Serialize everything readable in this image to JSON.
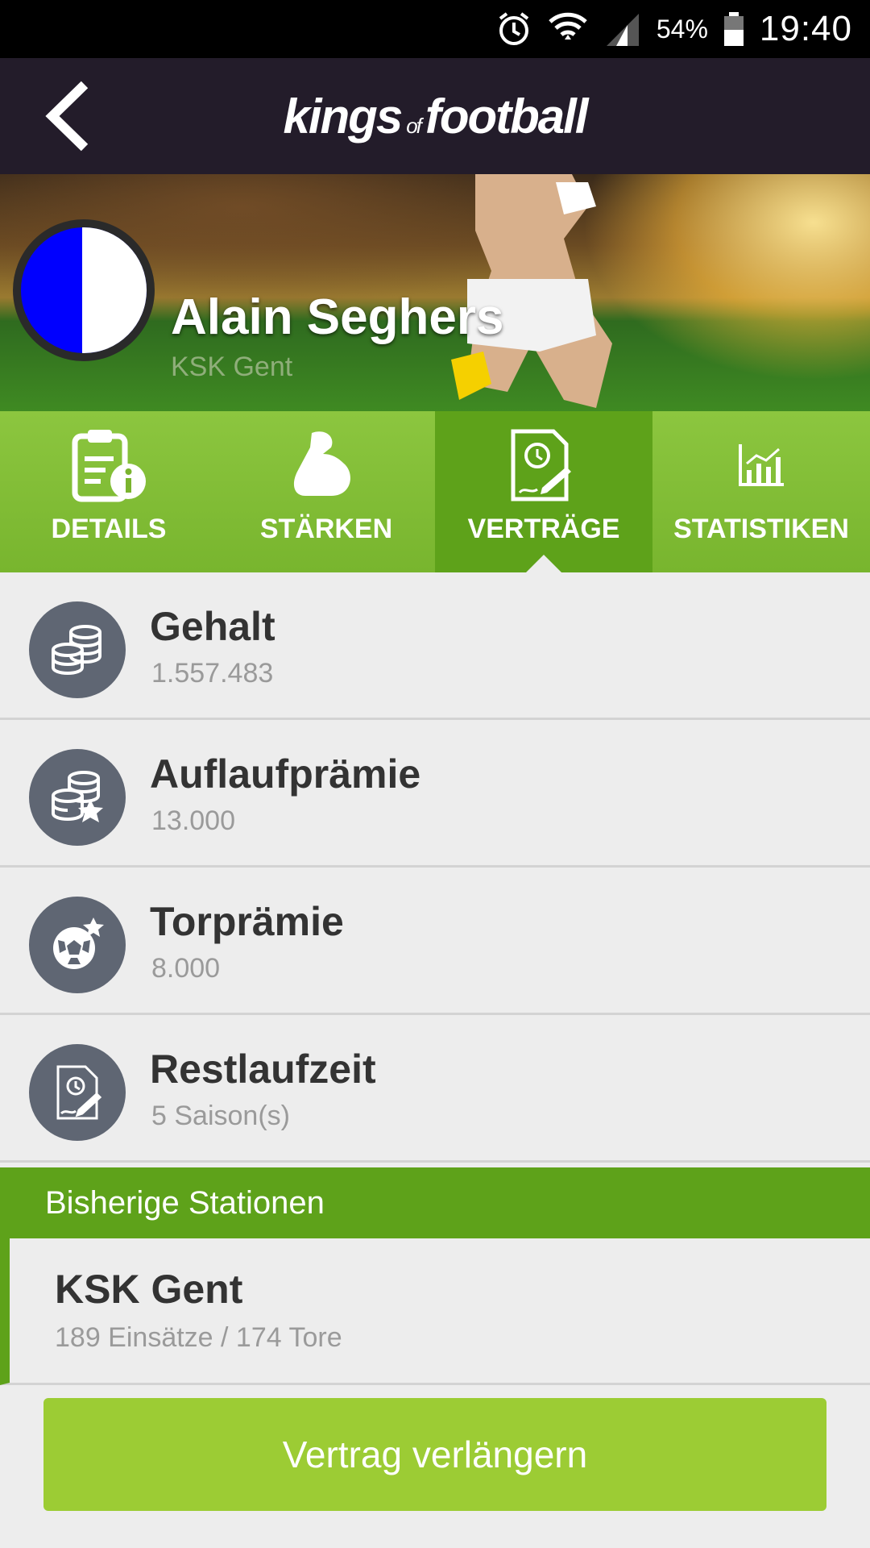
{
  "statusbar": {
    "battery_pct": "54%",
    "time": "19:40"
  },
  "appbar": {
    "brand_main_1": "kings",
    "brand_of": "of",
    "brand_main_2": "football"
  },
  "player": {
    "name": "Alain Seghers",
    "club": "KSK Gent"
  },
  "tabs": [
    {
      "label": "DETAILS",
      "icon": "document-info-icon",
      "active": false
    },
    {
      "label": "STÄRKEN",
      "icon": "muscle-icon",
      "active": false
    },
    {
      "label": "VERTRÄGE",
      "icon": "contract-icon",
      "active": true
    },
    {
      "label": "STATISTIKEN",
      "icon": "chart-icon",
      "active": false
    }
  ],
  "contract": [
    {
      "title": "Gehalt",
      "value": "1.557.483",
      "icon": "coins-icon"
    },
    {
      "title": "Auflaufprämie",
      "value": "13.000",
      "icon": "coins-star-icon"
    },
    {
      "title": "Torprämie",
      "value": "8.000",
      "icon": "ball-star-icon"
    },
    {
      "title": "Restlaufzeit",
      "value": "5 Saison(s)",
      "icon": "contract-icon"
    }
  ],
  "stations": {
    "heading": "Bisherige Stationen",
    "items": [
      {
        "club": "KSK Gent",
        "stats": "189 Einsätze / 174 Tore"
      }
    ]
  },
  "cta_label": "Vertrag verlängern",
  "colors": {
    "green": "#8cc63f",
    "green_dark": "#5ea21a",
    "cta": "#9ccc34",
    "appbar": "#231c2a",
    "icon_circle": "#5f6673"
  }
}
